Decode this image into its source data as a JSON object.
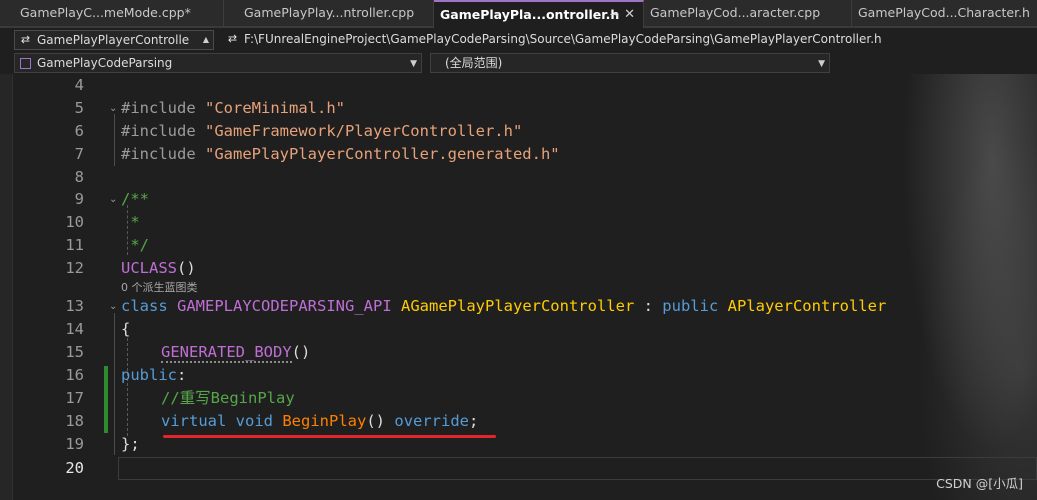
{
  "tabs": [
    {
      "label": "GamePlayC...meMode.cpp*",
      "active": false
    },
    {
      "label": "GamePlayPlay...ntroller.cpp",
      "active": false
    },
    {
      "label": "GamePlayPla...ontroller.h",
      "active": true
    },
    {
      "label": "GamePlayCod...aracter.cpp",
      "active": false
    },
    {
      "label": "GamePlayCod...Character.h",
      "active": false
    }
  ],
  "tab_pin_glyph": "⊸",
  "tab_close_glyph": "✕",
  "nav": {
    "file_combo": "GamePlayPlayerControlle",
    "file_path": "F:\\FUnrealEngineProject\\GamePlayCodeParsing\\Source\\GamePlayCodeParsing\\GamePlayPlayerController.h",
    "project_combo": "GamePlayCodeParsing",
    "scope_combo": "(全局范围)"
  },
  "code_lines": [
    {
      "n": "4"
    },
    {
      "n": "5",
      "pp": "#include ",
      "str": "\"CoreMinimal.h\""
    },
    {
      "n": "6",
      "pp": "#include ",
      "str": "\"GameFramework/PlayerController.h\""
    },
    {
      "n": "7",
      "pp": "#include ",
      "str": "\"GamePlayPlayerController.generated.h\""
    },
    {
      "n": "8"
    },
    {
      "n": "9",
      "com": "/**"
    },
    {
      "n": "10",
      "com": " *"
    },
    {
      "n": "11",
      "com": " */"
    },
    {
      "n": "12",
      "macro": "UCLASS",
      "plain": "()"
    },
    {
      "n": "13"
    },
    {
      "n": "14",
      "plain": "{"
    },
    {
      "n": "15",
      "macro": "GENERATED_BODY",
      "plain": "()"
    },
    {
      "n": "16",
      "acc": "public",
      "plain": ":"
    },
    {
      "n": "17",
      "com": "//重写BeginPlay"
    },
    {
      "n": "18"
    },
    {
      "n": "19",
      "plain": "};"
    },
    {
      "n": "20"
    }
  ],
  "line13": {
    "kw": "class",
    "macro": "GAMEPLAYCODEPARSING_API",
    "cls": "AGamePlayPlayerController",
    "sep": " : ",
    "kw2": "public",
    "cls2": "APlayerController"
  },
  "line18": {
    "kw": "virtual",
    "kw2": "void",
    "fn": "BeginPlay",
    "plain": "()",
    "kw3": "override",
    "end": ";"
  },
  "codelens": "0 个派生蓝图类",
  "watermark": "CSDN @[小瓜]",
  "colors": {
    "accent_tab": "#a074c4",
    "keyword": "#569cd6",
    "string": "#e7a27a",
    "comment": "#57a64a",
    "macro": "#be6fd4",
    "class": "#ffcc00",
    "function": "#ff8000",
    "change_bar": "#2f8a2f",
    "annotation_underline": "#e3262c"
  }
}
